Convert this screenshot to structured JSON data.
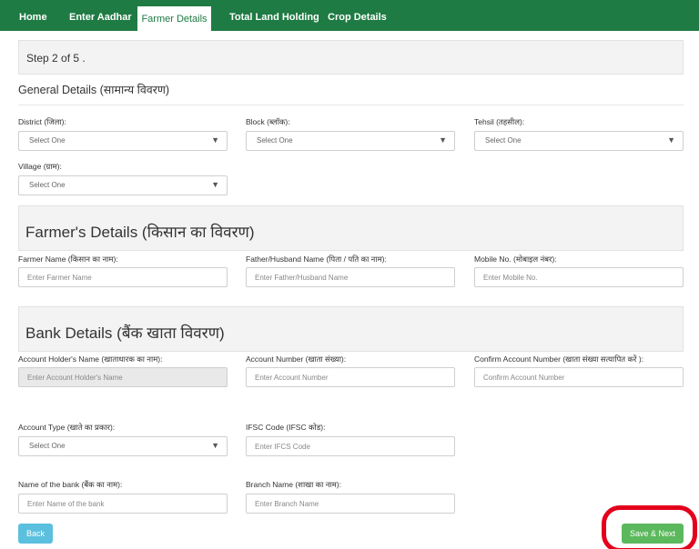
{
  "nav": {
    "items": [
      "Home",
      "Enter Aadhar",
      "Farmer Details",
      "Total Land Holding",
      "Crop Details"
    ],
    "active": "Farmer Details"
  },
  "step": {
    "text": "Step 2 of 5 ."
  },
  "general": {
    "title": "General Details (सामान्य विवरण)",
    "district": {
      "label": "District (जिला):",
      "value": "Select One"
    },
    "block": {
      "label": "Block (ब्लॉक):",
      "value": "Select One"
    },
    "tehsil": {
      "label": "Tehsil (तहसील):",
      "value": "Select One"
    },
    "village": {
      "label": "Village (ग्राम):",
      "value": "Select One"
    }
  },
  "farmer": {
    "title": "Farmer's Details (किसान का विवरण)",
    "name": {
      "label": "Farmer Name (किसान का नाम):",
      "placeholder": "Enter Farmer Name"
    },
    "father": {
      "label": "Father/Husband Name (पिता / पति का नाम):",
      "placeholder": "Enter Father/Husband Name"
    },
    "mobile": {
      "label": "Mobile No. (मोबाइल नंबर):",
      "placeholder": "Enter Mobile No."
    }
  },
  "bank": {
    "title": "Bank Details (बैंक खाता विवरण)",
    "holder": {
      "label": "Account Holder's Name (खाताधारक का नाम):",
      "placeholder": "Enter Account Holder's Name"
    },
    "account": {
      "label": "Account Number (खाता संख्या):",
      "placeholder": "Enter Account Number"
    },
    "confirm": {
      "label": "Confirm Account Number (खाता संख्या सत्यापित करें ):",
      "placeholder": "Confirm Account Number"
    },
    "type": {
      "label": "Account Type (खाते का प्रकार):",
      "value": "Select One"
    },
    "ifsc": {
      "label": "IFSC Code (IFSC कोड):",
      "placeholder": "Enter IFCS Code"
    },
    "bank_name": {
      "label": "Name of the bank (बैंक का नाम):",
      "placeholder": "Enter Name of the bank"
    },
    "branch": {
      "label": "Branch Name (शाखा का नाम):",
      "placeholder": "Enter Branch Name"
    }
  },
  "buttons": {
    "back": "Back",
    "next": "Save & Next"
  },
  "colors": {
    "nav": "#1e7b43",
    "back": "#5bc0de",
    "next": "#5cb85c",
    "highlight": "#e3001b"
  }
}
